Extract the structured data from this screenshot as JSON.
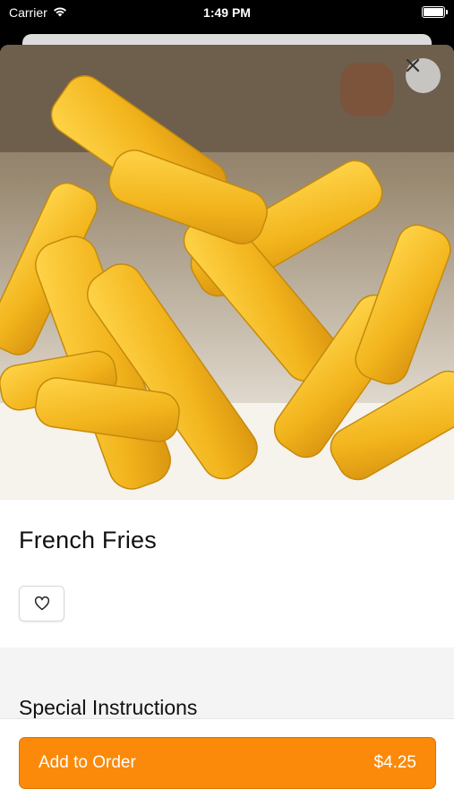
{
  "status": {
    "carrier": "Carrier",
    "time": "1:49 PM"
  },
  "item": {
    "title": "French Fries",
    "image_alt": "French Fries photo"
  },
  "sections": {
    "special_instructions": "Special Instructions"
  },
  "order": {
    "label": "Add to Order",
    "price": "$4.25"
  },
  "colors": {
    "accent": "#fb8a0a",
    "background": "#ffffff",
    "band": "#f4f4f4"
  }
}
